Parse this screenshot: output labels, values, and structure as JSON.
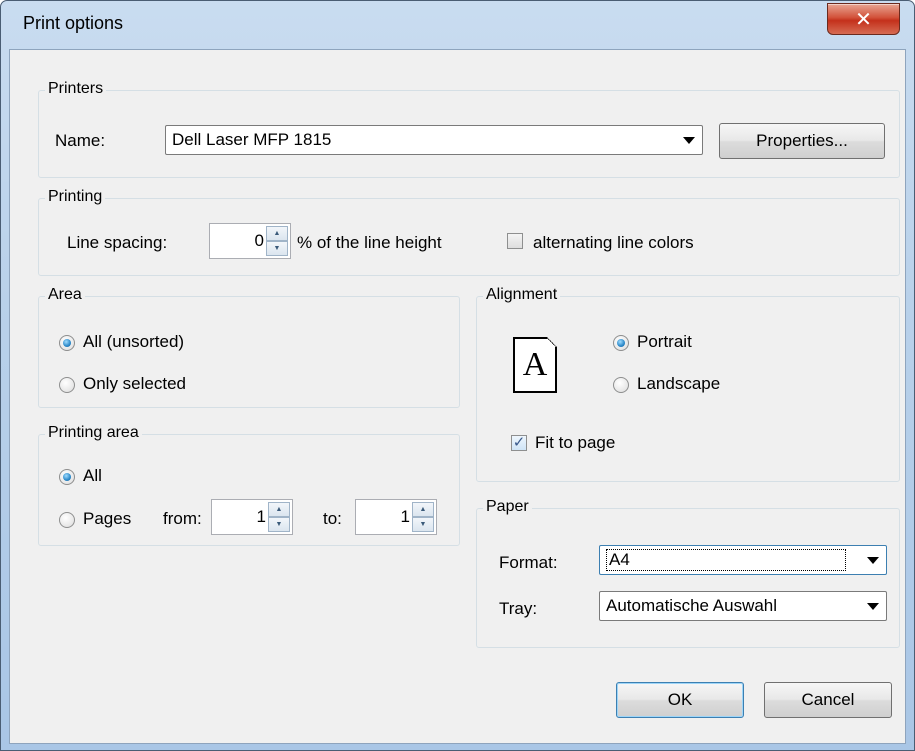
{
  "window": {
    "title": "Print options",
    "close_glyph": "✕"
  },
  "printers": {
    "legend": "Printers",
    "name_label": "Name:",
    "name_value": "Dell Laser MFP 1815",
    "properties_button": "Properties..."
  },
  "printing": {
    "legend": "Printing",
    "line_spacing_label": "Line spacing:",
    "line_spacing_value": "0",
    "line_spacing_suffix": "% of the line height",
    "alternating_label": "alternating line colors",
    "alternating_checked": false
  },
  "area": {
    "legend": "Area",
    "options": [
      {
        "label": "All (unsorted)",
        "checked": true
      },
      {
        "label": "Only selected",
        "checked": false
      }
    ]
  },
  "printing_area": {
    "legend": "Printing area",
    "all_label": "All",
    "pages_label": "Pages",
    "from_label": "from:",
    "from_value": "1",
    "to_label": "to:",
    "to_value": "1",
    "selected": "All"
  },
  "alignment": {
    "legend": "Alignment",
    "page_icon_letter": "A",
    "portrait_label": "Portrait",
    "landscape_label": "Landscape",
    "selected": "Portrait",
    "fit_to_page_label": "Fit to page",
    "fit_to_page_checked": true
  },
  "paper": {
    "legend": "Paper",
    "format_label": "Format:",
    "format_value": "A4",
    "tray_label": "Tray:",
    "tray_value": "Automatische Auswahl"
  },
  "buttons": {
    "ok": "OK",
    "cancel": "Cancel"
  }
}
